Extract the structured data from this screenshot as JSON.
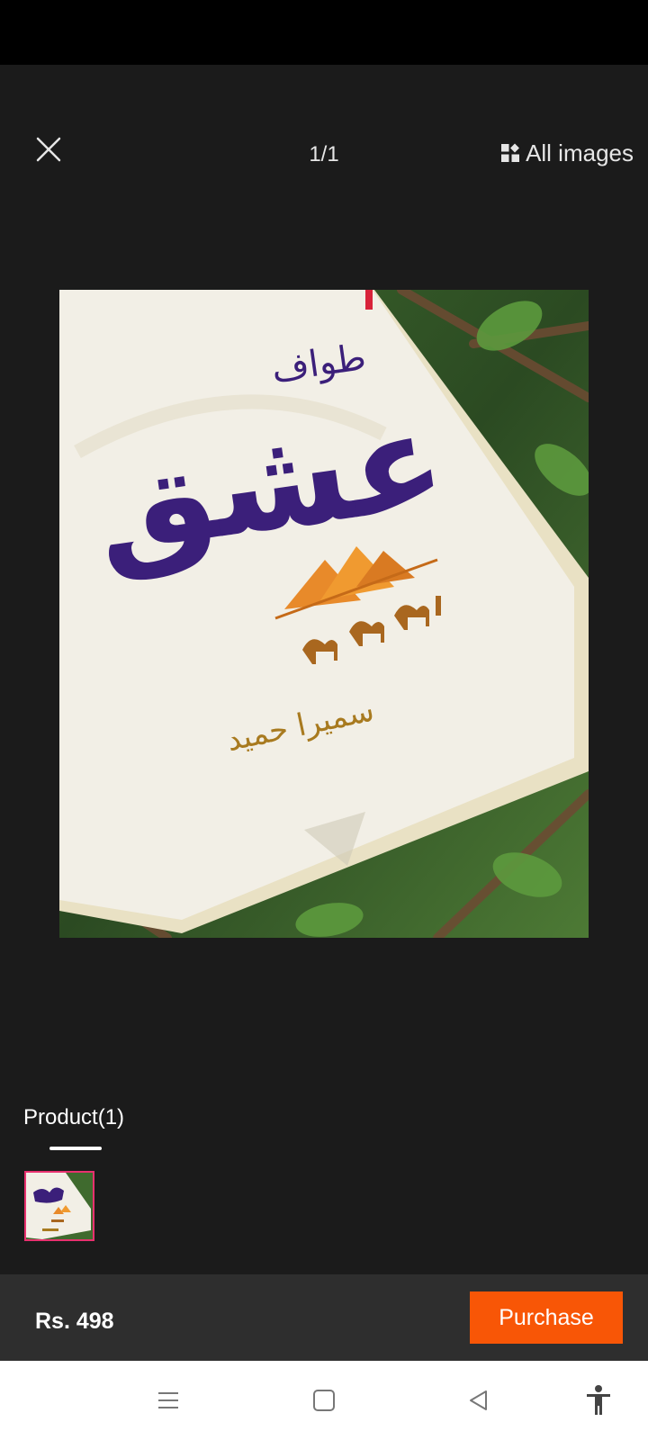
{
  "viewer": {
    "counter": "1/1",
    "all_images_label": "All images",
    "close_icon": "close-icon",
    "grid_icon": "gallery-grid-icon"
  },
  "photo": {
    "subject": "book-cover",
    "cover_title_small": "طواف",
    "cover_title_large": "عشق",
    "cover_author": "سمیرا حمید"
  },
  "product_tab": {
    "label": "Product(1)"
  },
  "bottom_bar": {
    "price": "Rs. 498",
    "purchase_label": "Purchase",
    "accent_color": "#f85606"
  },
  "nav": {
    "icons": [
      "menu-icon",
      "home-icon",
      "back-icon",
      "accessibility-icon"
    ]
  }
}
